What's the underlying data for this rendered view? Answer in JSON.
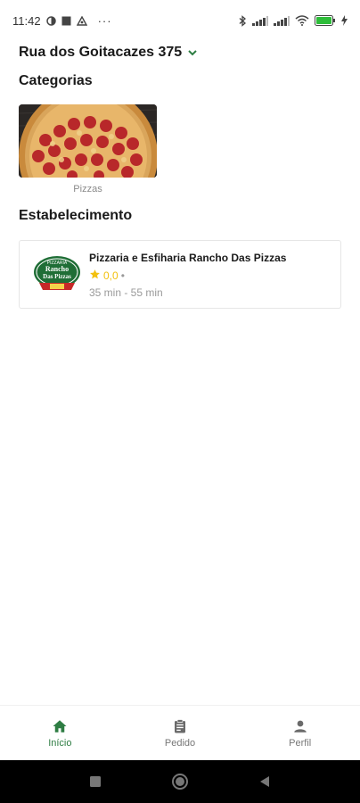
{
  "status_bar": {
    "time": "11:42",
    "more": "···"
  },
  "address": {
    "text": "Rua dos Goitacazes 375"
  },
  "categories": {
    "title": "Categorias",
    "items": [
      {
        "label": "Pizzas"
      }
    ]
  },
  "establishments": {
    "title": "Estabelecimento",
    "items": [
      {
        "name": "Pizzaria e Esfiharia Rancho Das Pizzas",
        "rating": "0,0",
        "dot": "•",
        "time": "35 min - 55 min",
        "logo": {
          "line1": "PIZZARIA",
          "line2": "Rancho",
          "line3": "Das Pizzas"
        }
      }
    ]
  },
  "bottom_nav": {
    "items": [
      {
        "label": "Início",
        "icon": "home-icon",
        "active": true
      },
      {
        "label": "Pedido",
        "icon": "clipboard-icon",
        "active": false
      },
      {
        "label": "Perfil",
        "icon": "person-icon",
        "active": false
      }
    ]
  },
  "colors": {
    "accent": "#2e7d43",
    "star": "#f2c00f",
    "muted": "#9a9a9a"
  }
}
